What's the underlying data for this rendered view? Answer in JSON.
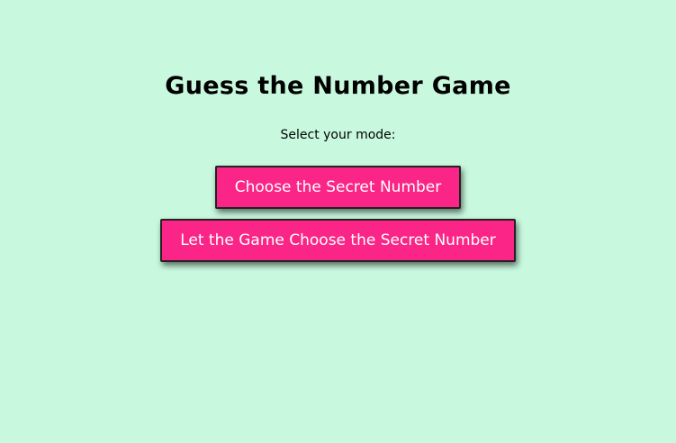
{
  "header": {
    "title": "Guess the Number Game",
    "subtitle": "Select your mode:"
  },
  "modes": {
    "choose_label": "Choose the Secret Number",
    "auto_label": "Let the Game Choose the Secret Number"
  },
  "colors": {
    "background": "#c8f9de",
    "button": "#fa2586",
    "button_text": "#ffffff"
  }
}
